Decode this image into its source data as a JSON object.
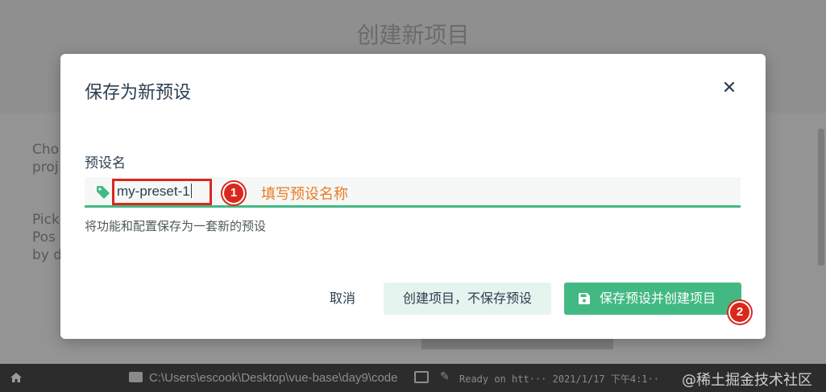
{
  "background": {
    "title": "创建新项目",
    "side_text_1": "Cho\nproj",
    "side_text_2": "Pick\nPos\nby d"
  },
  "dialog": {
    "title": "保存为新预设",
    "field_label": "预设名",
    "input_value": "my-preset-1",
    "annotation_1": "填写预设名称",
    "hint": "将功能和配置保存为一套新的预设",
    "cancel_label": "取消",
    "create_no_save_label": "创建项目，不保存预设",
    "save_and_create_label": "保存预设并创建项目",
    "badge_1": "1",
    "badge_2": "2"
  },
  "statusbar": {
    "path": "C:\\Users\\escook\\Desktop\\vue-base\\day9\\code",
    "log": "Ready on htt··· 2021/1/17 下午4:1··",
    "watermark": "@稀土掘金技术社区"
  },
  "colors": {
    "accent": "#42b983",
    "annotation_red": "#d9281e",
    "annotation_orange": "#ea7b25"
  }
}
